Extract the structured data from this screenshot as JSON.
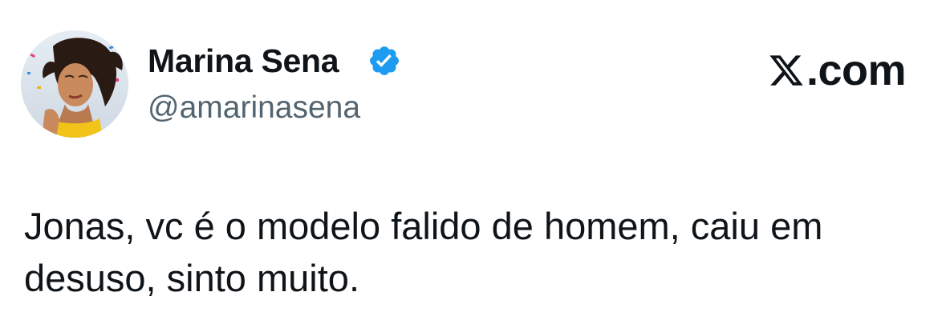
{
  "author": {
    "display_name": "Marina Sena",
    "handle": "@amarinasena",
    "verified": true,
    "avatar_icon": "profile-photo"
  },
  "brand": {
    "logo_icon": "x-logo-icon",
    "text": "X.com",
    "text_suffix": ".com"
  },
  "tweet": {
    "text": "Jonas, vc é o modelo falido de homem, caiu em desuso, sinto muito."
  },
  "colors": {
    "verified_badge": "#1d9bf0",
    "handle": "#536471",
    "text": "#0f1419",
    "background": "#ffffff"
  }
}
